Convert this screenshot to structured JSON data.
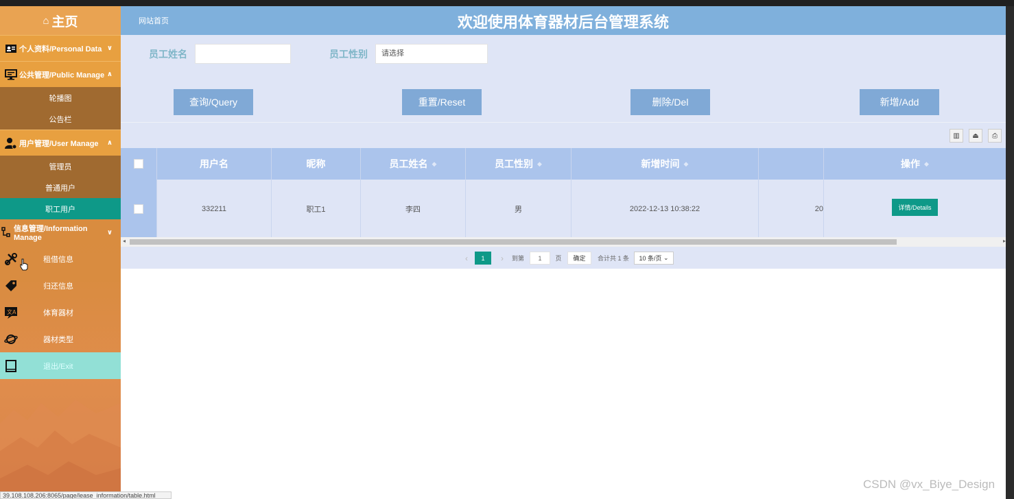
{
  "sidebar": {
    "home": "主页",
    "menus": [
      {
        "label": "个人资料/Personal Data",
        "chevron": "∨"
      },
      {
        "label": "公共管理/Public Manage",
        "chevron": "∧",
        "items": [
          "轮播图",
          "公告栏"
        ]
      },
      {
        "label": "用户管理/User Manage",
        "chevron": "∧",
        "items": [
          "管理员",
          "普通用户",
          "职工用户"
        ]
      },
      {
        "label": "信息管理/Information Manage",
        "chevron": "∨",
        "items": [
          "租借信息",
          "归还信息",
          "体育器材",
          "器材类型"
        ]
      }
    ],
    "exit": "退出/Exit"
  },
  "header": {
    "crumb": "网站首页",
    "title": "欢迎使用体育器材后台管理系统"
  },
  "search": {
    "name_label": "员工姓名",
    "name_value": "",
    "gender_label": "员工性别",
    "gender_placeholder": "请选择"
  },
  "buttons": {
    "query": "查询/Query",
    "reset": "重置/Reset",
    "del": "删除/Del",
    "add": "新增/Add"
  },
  "table": {
    "headers": [
      "用户名",
      "昵称",
      "员工姓名",
      "员工性别",
      "新增时间",
      "操作"
    ],
    "rows": [
      {
        "username": "332211",
        "nickname": "职工1",
        "name": "李四",
        "gender": "男",
        "created": "2022-12-13 10:38:22",
        "cut": "20",
        "action": "详情/Details"
      }
    ]
  },
  "pager": {
    "current": "1",
    "goto_label": "到第",
    "goto_value": "1",
    "page_unit": "页",
    "confirm": "确定",
    "total": "合计共 1 条",
    "size": "10 条/页"
  },
  "watermark": "CSDN @vx_Biye_Design",
  "status_url": "39.108.108.206:8065/page/lease_information/table.html",
  "colors": {
    "sidebar": "#d88a3a",
    "header": "#7fb0dc",
    "active": "#0e9988",
    "button": "#80a9d6"
  }
}
